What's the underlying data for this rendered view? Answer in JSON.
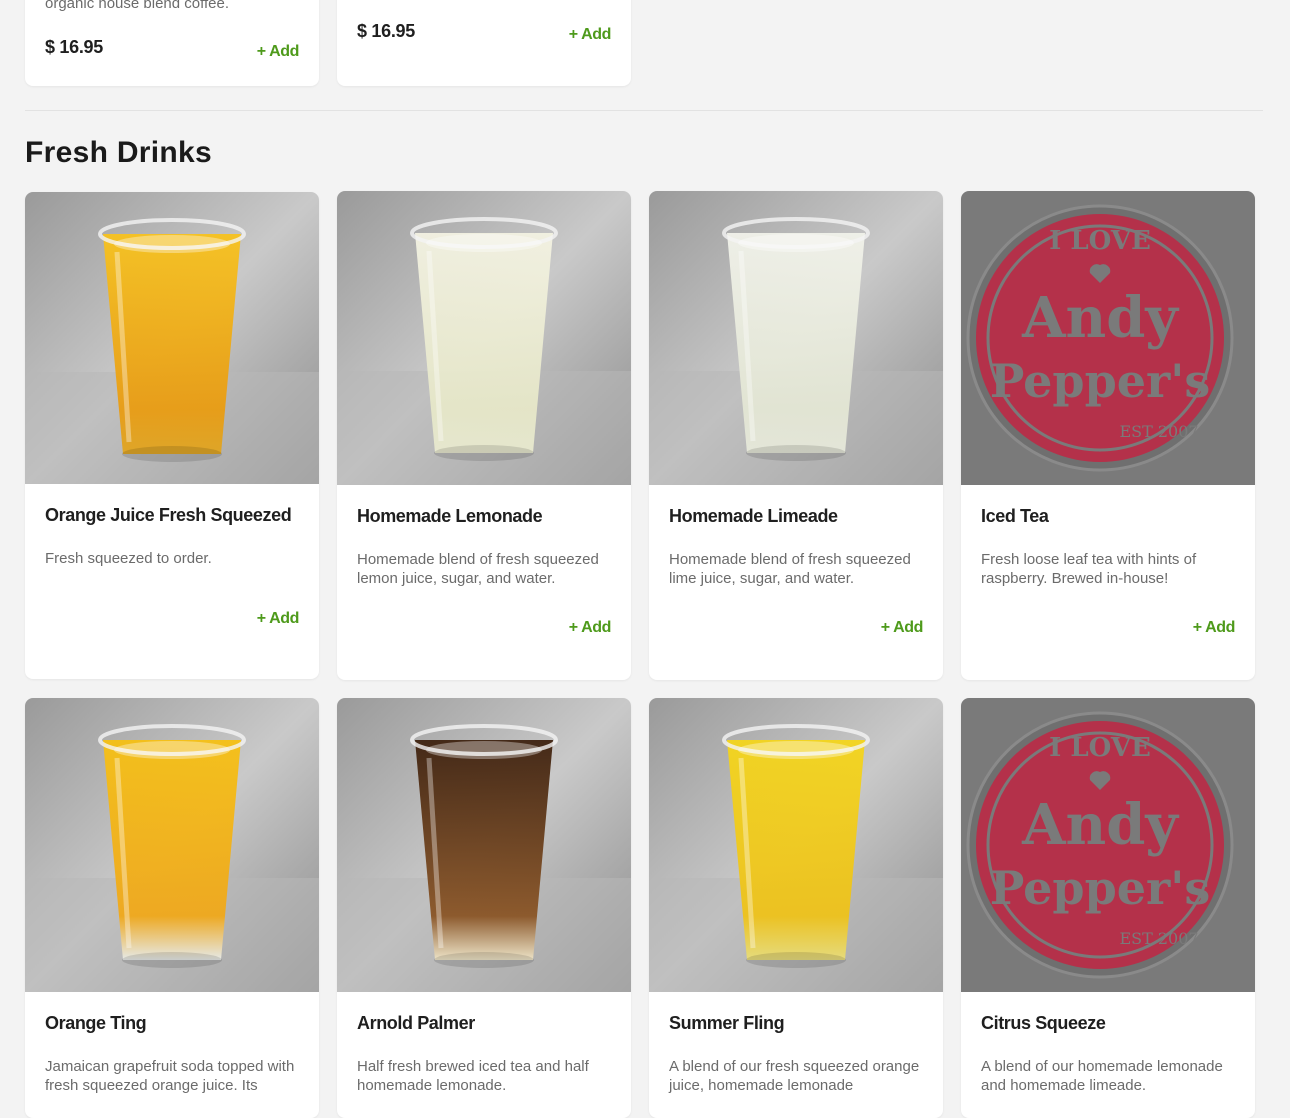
{
  "top_cards": [
    {
      "desc_tail": "organic house blend coffee.",
      "price": "$ 16.95",
      "add_label": "+ Add"
    },
    {
      "price": "$ 16.95",
      "add_label": "+ Add"
    }
  ],
  "section": {
    "title": "Fresh Drinks"
  },
  "logo": {
    "line1": "I LOVE",
    "line2": "Andy",
    "line3": "Pepper's",
    "est": "EST 2007"
  },
  "items": [
    {
      "name": "Orange Juice Fresh Squeezed",
      "desc": "Fresh squeezed to order.",
      "add_label": "+ Add",
      "image": "orange-juice"
    },
    {
      "name": "Homemade Lemonade",
      "desc": "Homemade blend of fresh squeezed lemon juice, sugar, and water.",
      "add_label": "+ Add",
      "image": "lemonade"
    },
    {
      "name": "Homemade Limeade",
      "desc": "Homemade blend of fresh squeezed lime juice, sugar, and water.",
      "add_label": "+ Add",
      "image": "limeade"
    },
    {
      "name": "Iced Tea",
      "desc": "Fresh loose leaf tea with hints of raspberry. Brewed in-house!",
      "add_label": "+ Add",
      "image": "andy-peppers-logo"
    },
    {
      "name": "Orange Ting",
      "desc": "Jamaican grapefruit soda topped with fresh squeezed orange juice. Its",
      "image": "orange-ting"
    },
    {
      "name": "Arnold Palmer",
      "desc": "Half fresh brewed iced tea and half homemade lemonade.",
      "image": "arnold-palmer"
    },
    {
      "name": "Summer Fling",
      "desc": "A blend of our fresh squeezed orange juice, homemade lemonade",
      "image": "summer-fling"
    },
    {
      "name": "Citrus Squeeze",
      "desc": "A blend of our homemade lemonade and homemade limeade.",
      "image": "andy-peppers-logo"
    }
  ],
  "colors": {
    "add_green": "#4e9a1b",
    "logo_red": "#b4314a",
    "placeholder_gray": "#7a7a7a",
    "orange_drink": "#f2b11a",
    "lemon_drink": "#eceed6",
    "tea_drink": "#5a2f14",
    "yellow_drink": "#f0d41c"
  }
}
